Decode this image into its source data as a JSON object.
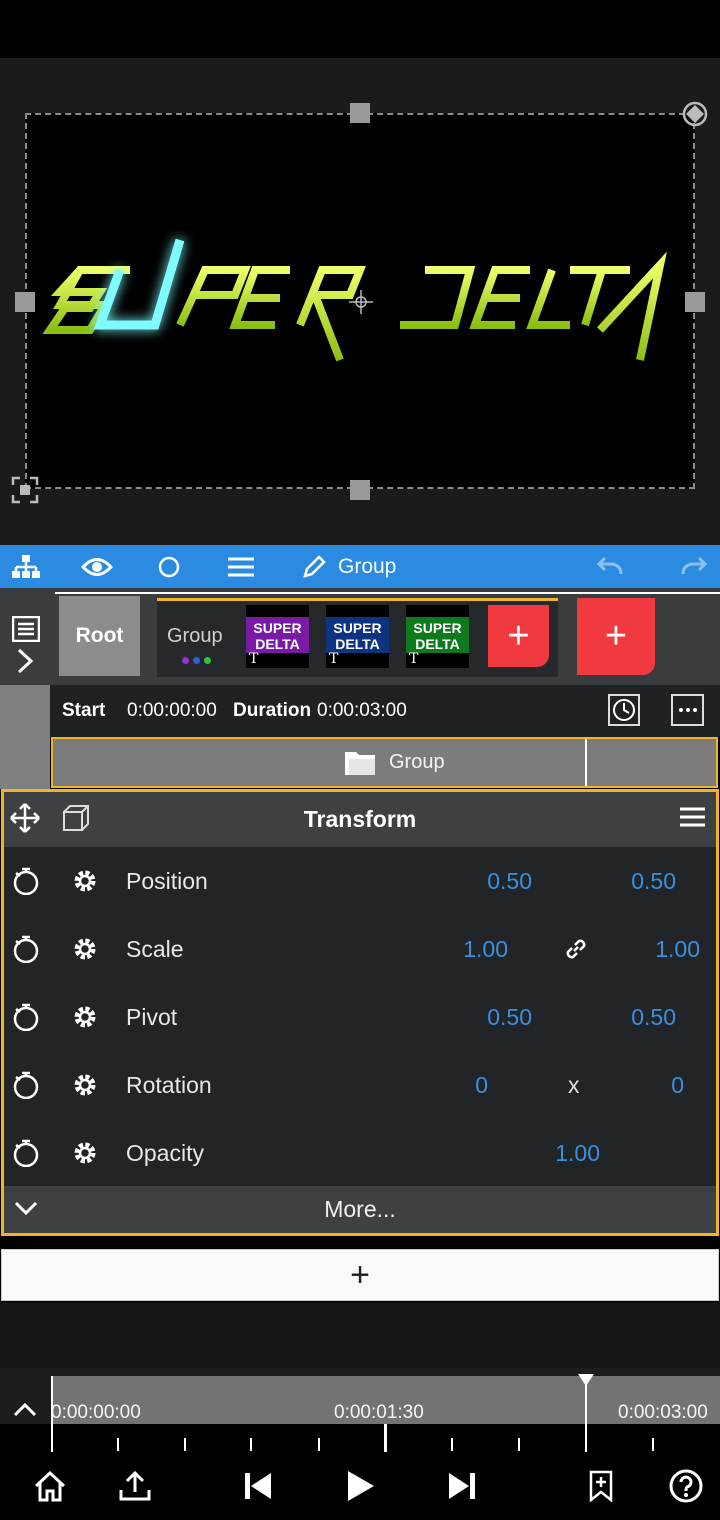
{
  "toolbar": {
    "group_label": "Group"
  },
  "layers": {
    "root_label": "Root",
    "group_label": "Group",
    "thumbnails": [
      {
        "line1": "SUPER",
        "line2": "DELTA",
        "color": "#7a1ba6"
      },
      {
        "line1": "SUPER",
        "line2": "DELTA",
        "color": "#0d3480"
      },
      {
        "line1": "SUPER",
        "line2": "DELTA",
        "color": "#0f7a1d"
      }
    ],
    "add_symbol": "+"
  },
  "info": {
    "start_label": "Start",
    "start_value": "0:00:00:00",
    "duration_label": "Duration",
    "duration_value": "0:00:03:00"
  },
  "groupbar": {
    "label": "Group"
  },
  "transform": {
    "title": "Transform",
    "rows": [
      {
        "label": "Position",
        "v1": "0.50",
        "sep": "",
        "v2": "0.50"
      },
      {
        "label": "Scale",
        "v1": "1.00",
        "sep": "link",
        "v2": "1.00"
      },
      {
        "label": "Pivot",
        "v1": "0.50",
        "sep": "",
        "v2": "0.50"
      },
      {
        "label": "Rotation",
        "v1": "0",
        "sep": "x",
        "v2": "0"
      },
      {
        "label": "Opacity",
        "v1": "",
        "sep": "",
        "v2": "1.00"
      }
    ],
    "more_label": "More..."
  },
  "add_layer_symbol": "+",
  "timeline": {
    "t0": "0:00:00:00",
    "t1": "0:00:01:30",
    "t2": "0:00:03:00"
  },
  "colors": {
    "accent_blue": "#2a8be0",
    "selection_orange": "#f0b429",
    "value_blue": "#3a8fe0",
    "add_red": "#f03a3f"
  }
}
